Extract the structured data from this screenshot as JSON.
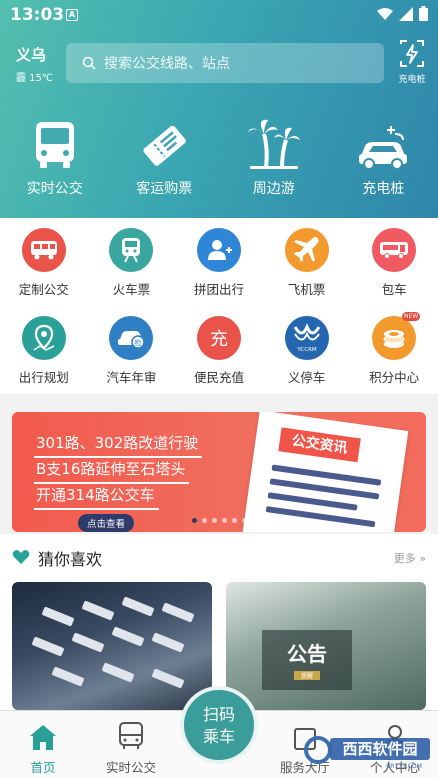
{
  "status": {
    "time": "13:03",
    "notif_letter": "A"
  },
  "header": {
    "city": "义乌",
    "weather": "霾 15℃",
    "search_placeholder": "搜索公交线路、站点",
    "charge_label": "充电桩"
  },
  "top_nav": [
    {
      "label": "实时公交",
      "icon": "bus-icon"
    },
    {
      "label": "客运购票",
      "icon": "ticket-icon"
    },
    {
      "label": "周边游",
      "icon": "palm-tree-icon"
    },
    {
      "label": "充电桩",
      "icon": "ev-car-icon"
    }
  ],
  "services": [
    {
      "label": "定制公交",
      "color": "#e9534a",
      "icon": "custom-bus-icon"
    },
    {
      "label": "火车票",
      "color": "#3aa6a0",
      "icon": "train-icon"
    },
    {
      "label": "拼团出行",
      "color": "#2f86d6",
      "icon": "group-user-icon"
    },
    {
      "label": "飞机票",
      "color": "#f29a2e",
      "icon": "plane-icon"
    },
    {
      "label": "包车",
      "color": "#f05a62",
      "icon": "charter-bus-icon"
    },
    {
      "label": "出行规划",
      "color": "#2aa198",
      "icon": "route-pin-icon"
    },
    {
      "label": "汽车年审",
      "color": "#2f7fc4",
      "icon": "car-inspection-icon"
    },
    {
      "label": "便民充值",
      "color": "#e9534a",
      "icon": "recharge-icon"
    },
    {
      "label": "义停车",
      "color": "#2566b0",
      "icon": "yiting-logo-icon",
      "logo_text": "YCCRM"
    },
    {
      "label": "积分中心",
      "color": "#f29a2e",
      "icon": "points-coin-icon",
      "badge": "NEW"
    }
  ],
  "banner": {
    "lines": [
      "301路、302路改道行驶",
      "B支16路延伸至石塔头",
      "开通314路公交车"
    ],
    "button": "点击查看",
    "paper_title": "公交资讯",
    "slides": 6,
    "active_slide": 0
  },
  "guess": {
    "title": "猜你喜欢",
    "more": "更多",
    "card2_title": "公告",
    "card2_badge": "提醒"
  },
  "bottom_nav": {
    "home": "首页",
    "realtime": "实时公交",
    "scan_line1": "扫码",
    "scan_line2": "乘车",
    "service": "服务大厅",
    "mine": "个人中心",
    "active_color": "#2aa198"
  },
  "watermark": {
    "name": "西西软件园",
    "url": "CR173.COM"
  }
}
